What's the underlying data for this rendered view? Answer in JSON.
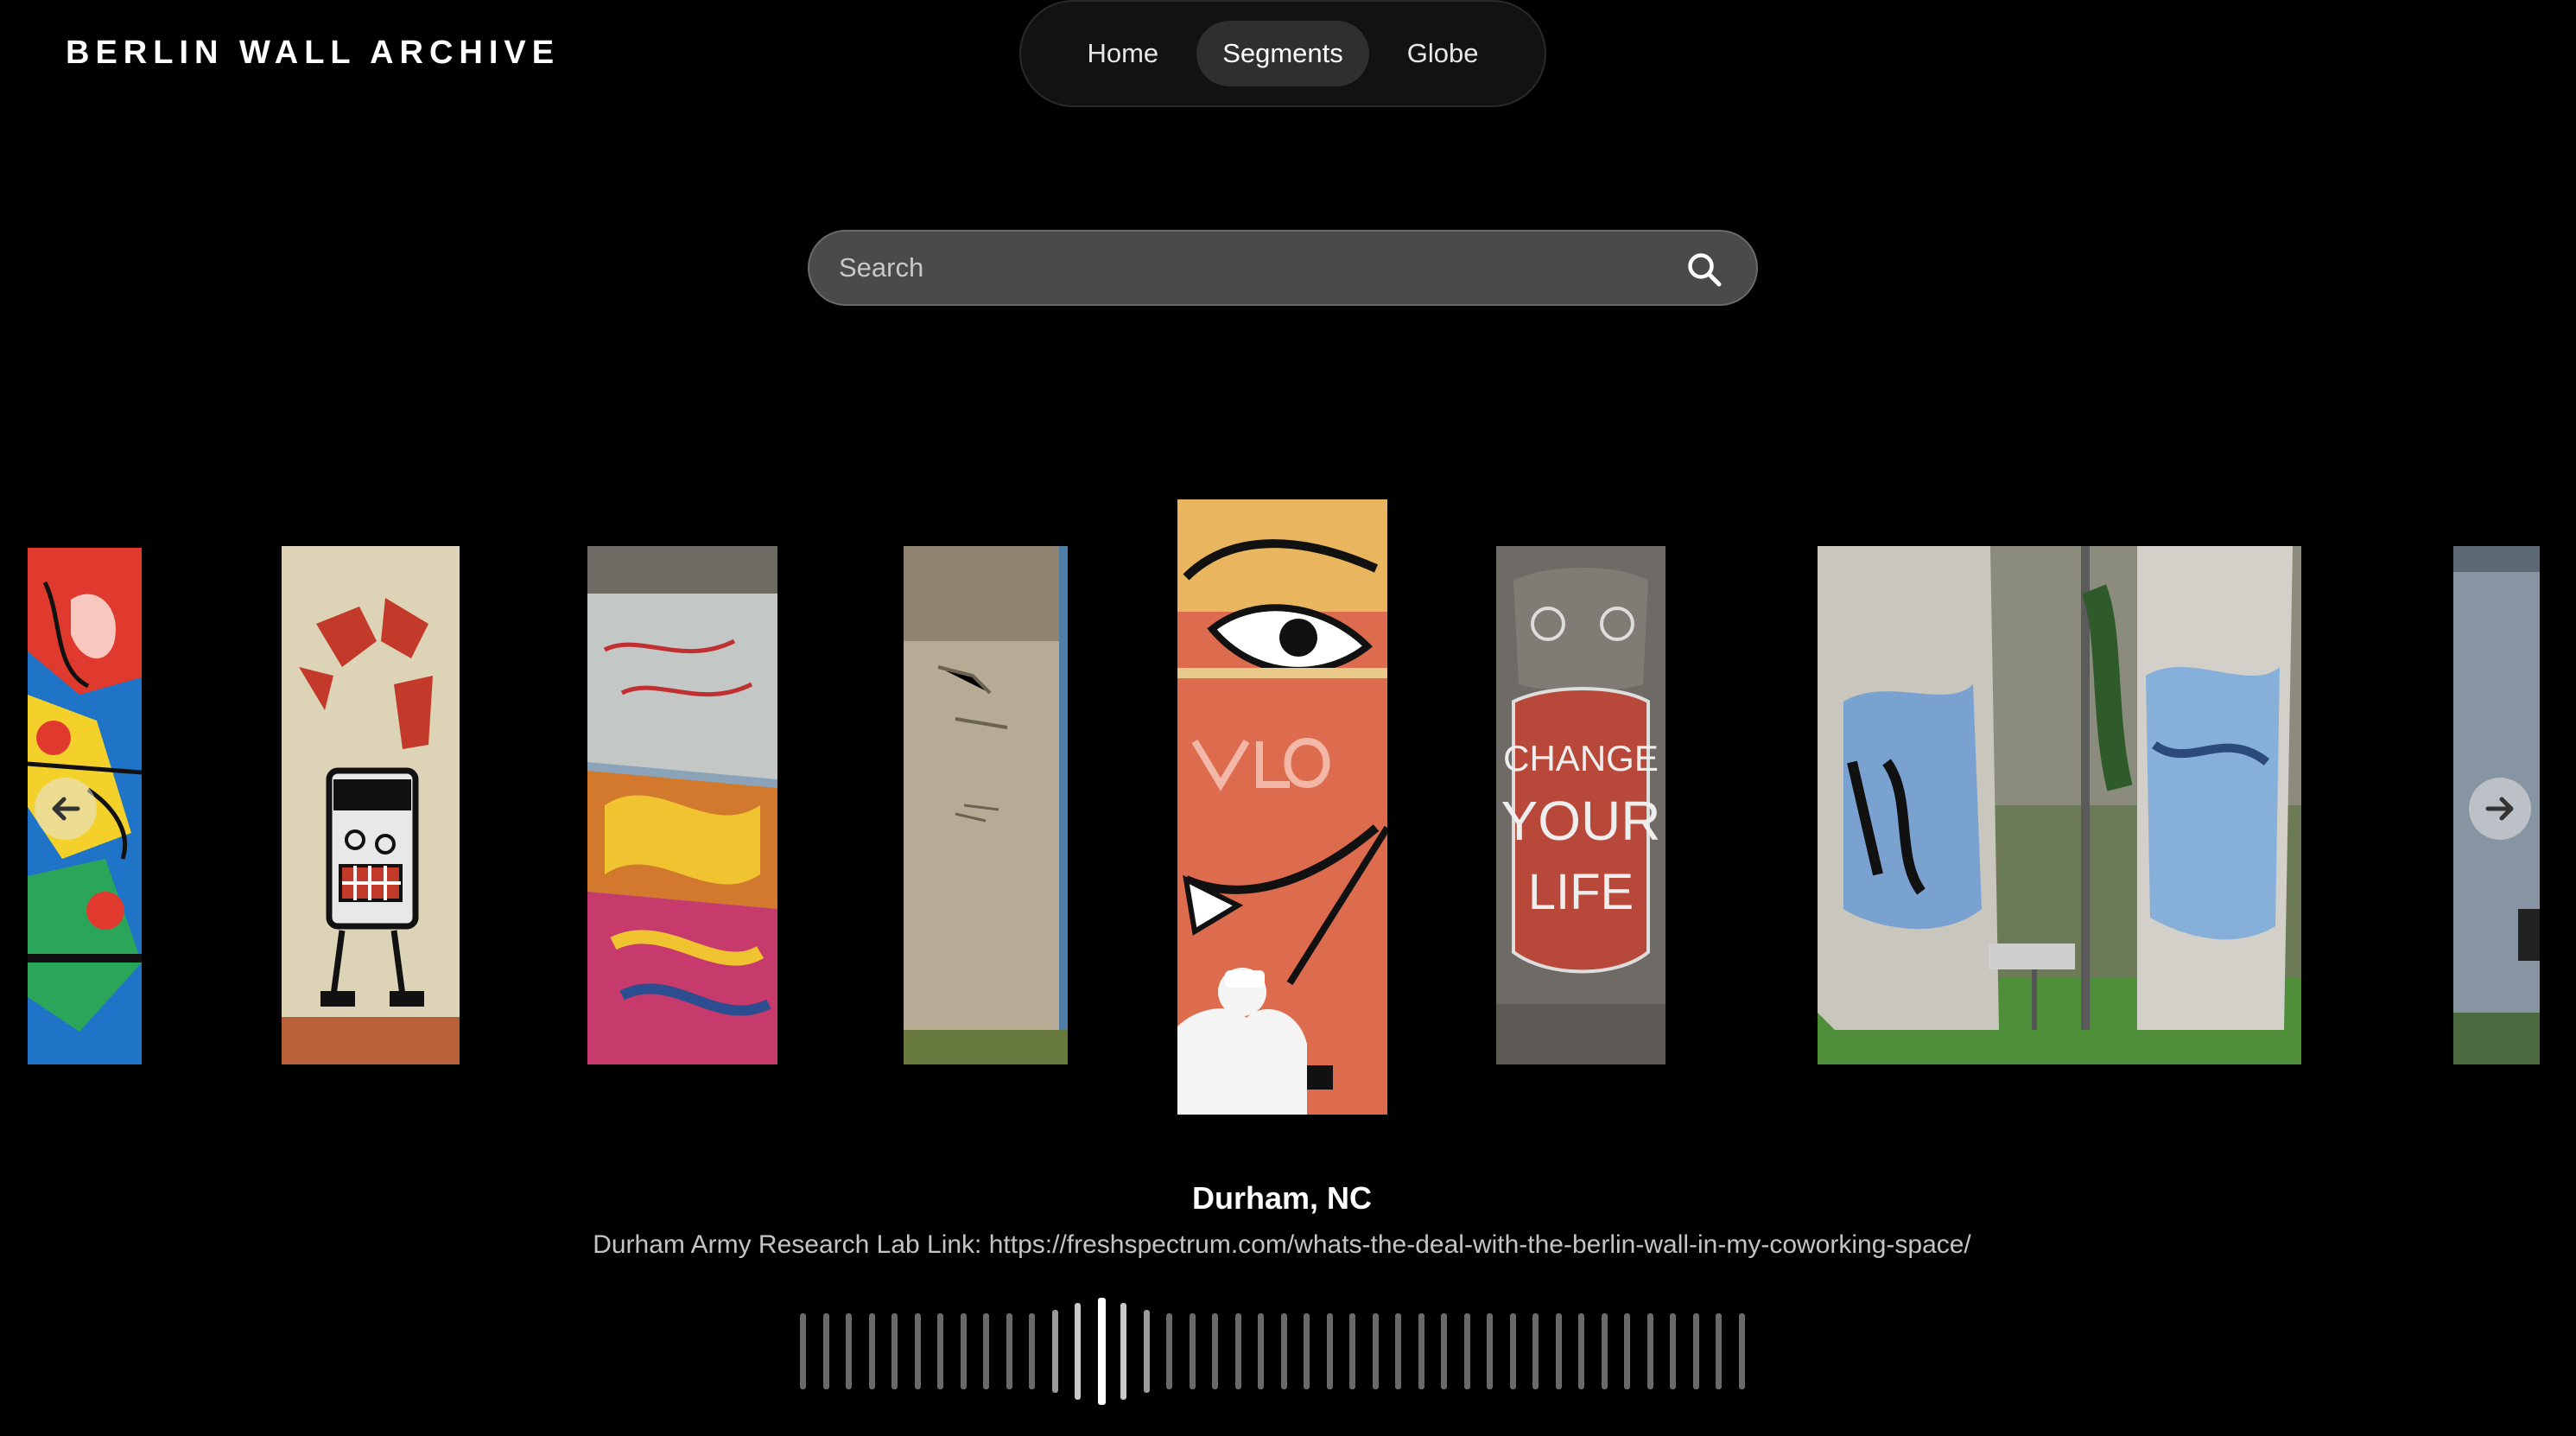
{
  "brand": {
    "title": "BERLIN WALL ARCHIVE"
  },
  "nav": {
    "items": [
      {
        "label": "Home",
        "active": false
      },
      {
        "label": "Segments",
        "active": true
      },
      {
        "label": "Globe",
        "active": false
      }
    ]
  },
  "search": {
    "placeholder": "Search",
    "value": "",
    "icon": "search-icon"
  },
  "carousel": {
    "prev_icon": "arrow-left-icon",
    "next_icon": "arrow-right-icon",
    "selected": {
      "title": "Durham, NC",
      "description": "Durham Army Research Lab Link: https://freshspectrum.com/whats-the-deal-with-the-berlin-wall-in-my-coworking-space/"
    },
    "panel_texts": {
      "change_your_life": [
        "CHANGE",
        "YOUR",
        "LIFE"
      ]
    }
  },
  "colors": {
    "background": "#000000",
    "nav_active": "#2f2f2f",
    "search_bg": "#4a4a4a",
    "tick": "#6a6a6a"
  },
  "scrubber": {
    "tick_count": 42,
    "selected_index": 13
  }
}
